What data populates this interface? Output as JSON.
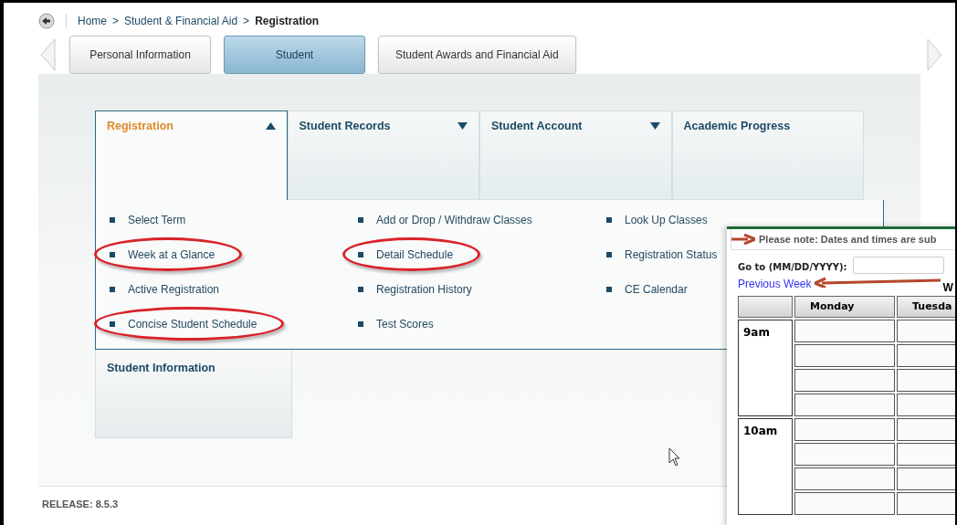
{
  "breadcrumb": {
    "items": [
      {
        "label": "Home",
        "current": false
      },
      {
        "label": "Student & Financial Aid",
        "current": false
      },
      {
        "label": "Registration",
        "current": true
      }
    ],
    "separator": ">"
  },
  "tabs": [
    {
      "label": "Personal Information",
      "selected": false
    },
    {
      "label": "Student",
      "selected": true
    },
    {
      "label": "Student Awards and Financial Aid",
      "selected": false
    }
  ],
  "menu_tabs": [
    {
      "label": "Registration",
      "kind": "dropdown",
      "expanded": true
    },
    {
      "label": "Student Records",
      "kind": "dropdown",
      "expanded": false
    },
    {
      "label": "Student Account",
      "kind": "dropdown",
      "expanded": false
    },
    {
      "label": "Academic Progress",
      "kind": "plain",
      "expanded": false
    }
  ],
  "registration_links": [
    [
      {
        "label": "Select Term",
        "highlighted": false
      },
      {
        "label": "Week at a Glance",
        "highlighted": true
      },
      {
        "label": "Active Registration",
        "highlighted": false
      },
      {
        "label": "Concise Student Schedule",
        "highlighted": true
      }
    ],
    [
      {
        "label": "Add or Drop / Withdraw Classes",
        "highlighted": false
      },
      {
        "label": "Detail Schedule",
        "highlighted": true
      },
      {
        "label": "Registration History",
        "highlighted": false
      },
      {
        "label": "Test Scores",
        "highlighted": false
      }
    ],
    [
      {
        "label": "Look Up Classes",
        "highlighted": false
      },
      {
        "label": "Registration Status",
        "highlighted": false
      },
      {
        "label": "CE Calendar",
        "highlighted": false
      }
    ]
  ],
  "student_information": {
    "title": "Student Information"
  },
  "release": "RELEASE: 8.5.3",
  "schedule_window": {
    "note": "Please note: Dates and times are sub",
    "goto_label": "Go to (MM/DD/YYYY):",
    "previous_week": "Previous Week",
    "week_heading": "W",
    "columns": [
      "",
      "Monday",
      "Tuesda"
    ],
    "rows": [
      "9am",
      "10am"
    ]
  }
}
